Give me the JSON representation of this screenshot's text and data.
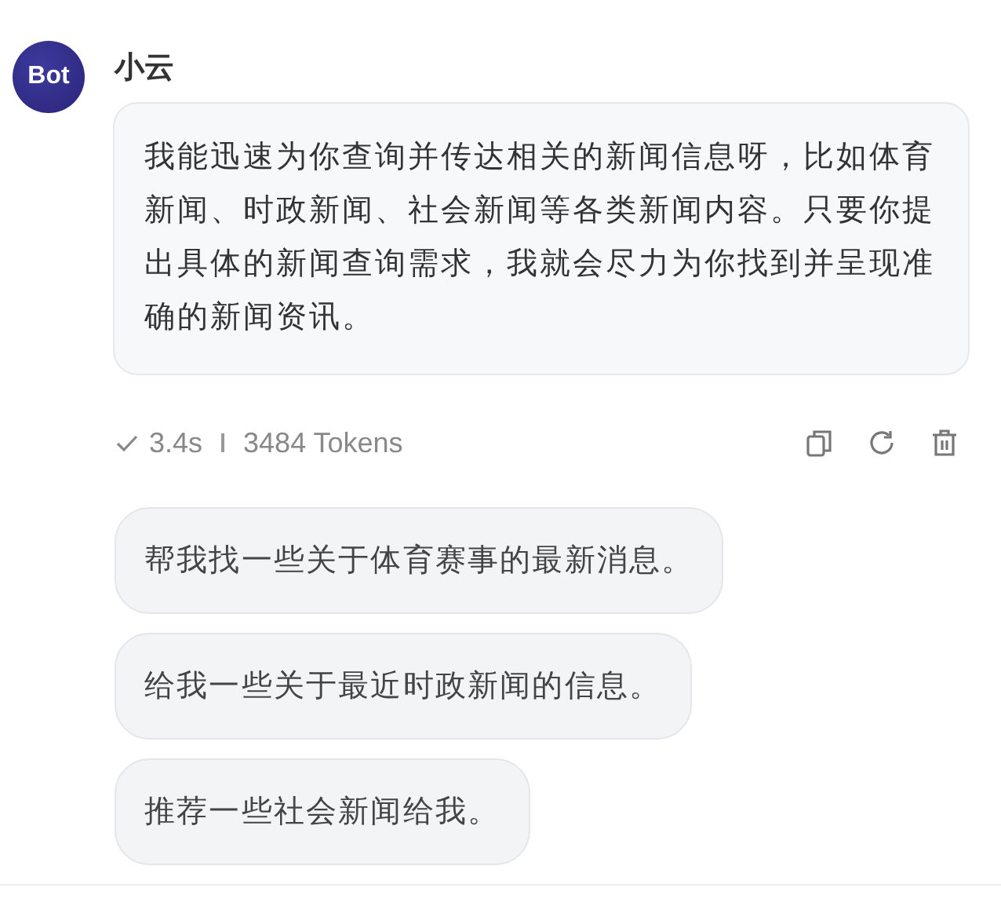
{
  "avatar": {
    "label": "Bot"
  },
  "sender": "小云",
  "message": "我能迅速为你查询并传达相关的新闻信息呀，比如体育新闻、时政新闻、社会新闻等各类新闻内容。只要你提出具体的新闻查询需求，我就会尽力为你找到并呈现准确的新闻资讯。",
  "meta": {
    "completed": true,
    "duration": "3.4s",
    "tokens": "3484 Tokens"
  },
  "actions": [
    {
      "kind": "copy"
    },
    {
      "kind": "regenerate"
    },
    {
      "kind": "delete"
    }
  ],
  "suggestions": [
    "帮我找一些关于体育赛事的最新消息。",
    "给我一些关于最近时政新闻的信息。",
    "推荐一些社会新闻给我。"
  ]
}
